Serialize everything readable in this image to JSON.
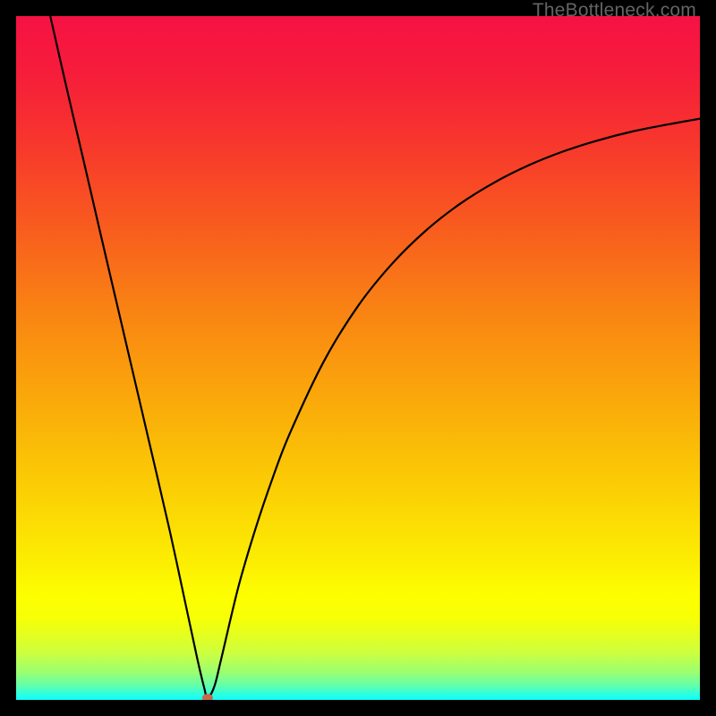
{
  "watermark": "TheBottleneck.com",
  "chart_data": {
    "type": "line",
    "title": "",
    "xlabel": "",
    "ylabel": "",
    "xlim": [
      0,
      100
    ],
    "ylim": [
      0,
      100
    ],
    "minimum_x": 28,
    "grid": false,
    "background_gradient": {
      "stops": [
        {
          "offset": 0.0,
          "color": "#f51244"
        },
        {
          "offset": 0.08,
          "color": "#f61c3b"
        },
        {
          "offset": 0.18,
          "color": "#f7352d"
        },
        {
          "offset": 0.3,
          "color": "#f8591f"
        },
        {
          "offset": 0.42,
          "color": "#f98014"
        },
        {
          "offset": 0.55,
          "color": "#faa60b"
        },
        {
          "offset": 0.68,
          "color": "#fbcb05"
        },
        {
          "offset": 0.8,
          "color": "#fcee02"
        },
        {
          "offset": 0.85,
          "color": "#fdff01"
        },
        {
          "offset": 0.88,
          "color": "#f7ff06"
        },
        {
          "offset": 0.9,
          "color": "#e8ff1a"
        },
        {
          "offset": 0.93,
          "color": "#ceff3d"
        },
        {
          "offset": 0.96,
          "color": "#9aff72"
        },
        {
          "offset": 0.98,
          "color": "#5fffae"
        },
        {
          "offset": 0.99,
          "color": "#34ffd8"
        },
        {
          "offset": 1.0,
          "color": "#0dfffd"
        }
      ]
    },
    "series": [
      {
        "name": "bottleneck-curve",
        "color": "#000000",
        "x": [
          5.0,
          7.5,
          10.0,
          12.5,
          15.0,
          17.5,
          20.0,
          22.5,
          25.0,
          26.5,
          27.5,
          28.0,
          29.0,
          30.0,
          32.5,
          35.0,
          37.5,
          40.0,
          45.0,
          50.0,
          55.0,
          60.0,
          65.0,
          70.0,
          75.0,
          80.0,
          85.0,
          90.0,
          95.0,
          100.0
        ],
        "values": [
          100.0,
          89.0,
          78.3,
          67.5,
          56.8,
          46.1,
          35.4,
          24.6,
          13.0,
          6.0,
          1.8,
          0.3,
          2.0,
          6.0,
          16.5,
          25.0,
          32.4,
          38.9,
          49.5,
          57.6,
          63.8,
          68.7,
          72.6,
          75.7,
          78.2,
          80.2,
          81.8,
          83.1,
          84.1,
          85.0
        ]
      }
    ],
    "marker": {
      "x": 28,
      "y": 0.3,
      "color": "#c76a4c",
      "rx": 6,
      "ry": 4.5
    }
  }
}
